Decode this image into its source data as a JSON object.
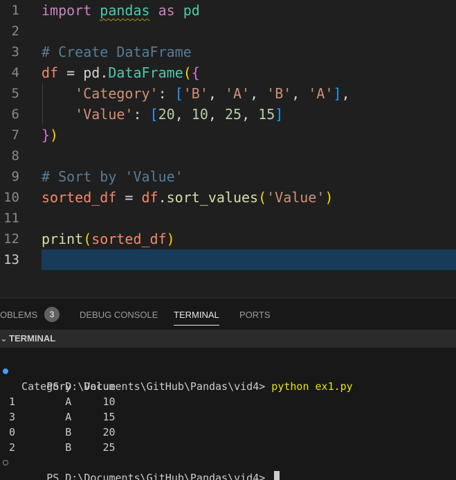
{
  "editor": {
    "lines": [
      {
        "num": "1",
        "tokens": [
          {
            "t": "import",
            "c": "t-kw"
          },
          {
            "t": " ",
            "c": "t-plain"
          },
          {
            "t": "pandas",
            "c": "t-mod squiggle"
          },
          {
            "t": " ",
            "c": "t-plain"
          },
          {
            "t": "as",
            "c": "t-kw"
          },
          {
            "t": " ",
            "c": "t-plain"
          },
          {
            "t": "pd",
            "c": "t-mod"
          }
        ]
      },
      {
        "num": "2",
        "tokens": []
      },
      {
        "num": "3",
        "tokens": [
          {
            "t": "# Create DataFrame",
            "c": "t-com2"
          }
        ]
      },
      {
        "num": "4",
        "tokens": [
          {
            "t": "df",
            "c": "t-id"
          },
          {
            "t": " = ",
            "c": "t-plain"
          },
          {
            "t": "pd",
            "c": "t-plain"
          },
          {
            "t": ".",
            "c": "t-plain"
          },
          {
            "t": "DataFrame",
            "c": "t-mod"
          },
          {
            "t": "(",
            "c": "t-b1"
          },
          {
            "t": "{",
            "c": "t-b2"
          }
        ]
      },
      {
        "num": "5",
        "tokens": [
          {
            "t": "    ",
            "c": "t-plain"
          },
          {
            "t": "'Category'",
            "c": "t-str"
          },
          {
            "t": ": ",
            "c": "t-plain"
          },
          {
            "t": "[",
            "c": "t-b3"
          },
          {
            "t": "'B'",
            "c": "t-str"
          },
          {
            "t": ", ",
            "c": "t-plain"
          },
          {
            "t": "'A'",
            "c": "t-str"
          },
          {
            "t": ", ",
            "c": "t-plain"
          },
          {
            "t": "'B'",
            "c": "t-str"
          },
          {
            "t": ", ",
            "c": "t-plain"
          },
          {
            "t": "'A'",
            "c": "t-str"
          },
          {
            "t": "]",
            "c": "t-b3"
          },
          {
            "t": ",",
            "c": "t-plain"
          }
        ]
      },
      {
        "num": "6",
        "tokens": [
          {
            "t": "    ",
            "c": "t-plain"
          },
          {
            "t": "'Value'",
            "c": "t-str"
          },
          {
            "t": ": ",
            "c": "t-plain"
          },
          {
            "t": "[",
            "c": "t-b3"
          },
          {
            "t": "20",
            "c": "t-num"
          },
          {
            "t": ", ",
            "c": "t-plain"
          },
          {
            "t": "10",
            "c": "t-num"
          },
          {
            "t": ", ",
            "c": "t-plain"
          },
          {
            "t": "25",
            "c": "t-num"
          },
          {
            "t": ", ",
            "c": "t-plain"
          },
          {
            "t": "15",
            "c": "t-num"
          },
          {
            "t": "]",
            "c": "t-b3"
          }
        ]
      },
      {
        "num": "7",
        "tokens": [
          {
            "t": "}",
            "c": "t-b2"
          },
          {
            "t": ")",
            "c": "t-b1"
          }
        ]
      },
      {
        "num": "8",
        "tokens": []
      },
      {
        "num": "9",
        "tokens": [
          {
            "t": "# Sort by 'Value'",
            "c": "t-com2"
          }
        ]
      },
      {
        "num": "10",
        "tokens": [
          {
            "t": "sorted_df",
            "c": "t-id"
          },
          {
            "t": " = ",
            "c": "t-plain"
          },
          {
            "t": "df",
            "c": "t-id"
          },
          {
            "t": ".",
            "c": "t-plain"
          },
          {
            "t": "sort_values",
            "c": "t-fn"
          },
          {
            "t": "(",
            "c": "t-b1"
          },
          {
            "t": "'Value'",
            "c": "t-str"
          },
          {
            "t": ")",
            "c": "t-b1"
          }
        ]
      },
      {
        "num": "11",
        "tokens": []
      },
      {
        "num": "12",
        "tokens": [
          {
            "t": "print",
            "c": "t-fn"
          },
          {
            "t": "(",
            "c": "t-b1"
          },
          {
            "t": "sorted_df",
            "c": "t-id"
          },
          {
            "t": ")",
            "c": "t-b1"
          }
        ]
      },
      {
        "num": "13",
        "tokens": [],
        "current": true
      }
    ]
  },
  "panel": {
    "tabs": {
      "problems": "OBLEMS",
      "problems_count": "3",
      "debug_console": "DEBUG CONSOLE",
      "terminal": "TERMINAL",
      "ports": "PORTS"
    },
    "section_title": "TERMINAL",
    "section_chevron": "⌄"
  },
  "terminal": {
    "prompt1": "PS D:\\Documents\\GitHub\\Pandas\\vid4> ",
    "command": "python ex1.py",
    "output": [
      "  Category  Value",
      "1        A     10",
      "3        A     15",
      "0        B     20",
      "2        B     25"
    ],
    "prompt2": "PS D:\\Documents\\GitHub\\Pandas\\vid4> "
  },
  "colors": {
    "editor_bg": "#1f1f1f",
    "current_line": "#173b59",
    "terminal_bg": "#181818",
    "command": "#e5e510",
    "badge": "#616161"
  }
}
